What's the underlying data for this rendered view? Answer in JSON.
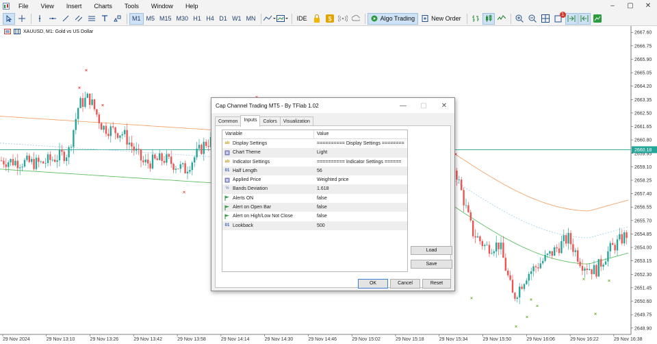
{
  "menubar": {
    "items": [
      "File",
      "View",
      "Insert",
      "Charts",
      "Tools",
      "Window",
      "Help"
    ],
    "window_controls": [
      "–",
      "▢",
      "✕"
    ]
  },
  "toolbar": {
    "timeframes": [
      "M1",
      "M5",
      "M15",
      "M30",
      "H1",
      "H4",
      "D1",
      "W1",
      "MN"
    ],
    "active_timeframe": "M1",
    "ide_label": "IDE",
    "algo_trading_label": "Algo Trading",
    "new_order_label": "New Order",
    "notification_count": "1"
  },
  "chart": {
    "symbol_label": "XAUUSD, M1:  Gold vs US Dollar",
    "current_price_label": "2660.18",
    "bg_color": "#ffffff",
    "bull_color": "#26a69a",
    "bear_color": "#ef5350"
  },
  "chart_data": {
    "type": "candlestick",
    "price_axis": [
      "2667.60",
      "2666.75",
      "2665.90",
      "2665.05",
      "2664.20",
      "2663.35",
      "2662.50",
      "2661.65",
      "2660.80",
      "2659.95",
      "2659.10",
      "2658.25",
      "2657.40",
      "2656.55",
      "2655.70",
      "2654.85",
      "2654.00",
      "2653.15",
      "2652.30",
      "2651.45",
      "2650.60",
      "2649.75",
      "2648.90"
    ],
    "time_axis": [
      "29 Nov 2024",
      "29 Nov 13:10",
      "29 Nov 13:26",
      "29 Nov 13:42",
      "29 Nov 13:58",
      "29 Nov 14:14",
      "29 Nov 14:30",
      "29 Nov 14:46",
      "29 Nov 15:02",
      "29 Nov 15:18",
      "29 Nov 15:34",
      "29 Nov 15:50",
      "29 Nov 16:06",
      "29 Nov 16:22",
      "29 Nov 16:38"
    ],
    "ylim": [
      2648.5,
      2668.0
    ],
    "current_price": 2660.18
  },
  "dialog": {
    "title": "Cap Channel Trading MT5 - By TFlab 1.02",
    "tabs": [
      "Common",
      "Inputs",
      "Colors",
      "Visualization"
    ],
    "active_tab": "Inputs",
    "table_header": {
      "variable": "Variable",
      "value": "Value"
    },
    "params": [
      {
        "icon": "ab-icon",
        "name": "Display Settings",
        "value": "========== Display Settings ========"
      },
      {
        "icon": "theme-icon",
        "name": "Chart Theme",
        "value": "Light"
      },
      {
        "icon": "ab-icon",
        "name": "Indicator Settings",
        "value": "========== Indicator Settings ======"
      },
      {
        "icon": "number-icon",
        "name": "Half Length",
        "value": "56"
      },
      {
        "icon": "theme-icon",
        "name": "Applied Price",
        "value": "Weighted price"
      },
      {
        "icon": "fraction-icon",
        "name": "Bands Deviation",
        "value": "1.618"
      },
      {
        "icon": "flag-icon",
        "name": "Alerts ON",
        "value": "false"
      },
      {
        "icon": "flag-icon",
        "name": "Alert on Open Bar",
        "value": "false"
      },
      {
        "icon": "flag-icon",
        "name": "Alert on High/Low Not Close",
        "value": "false"
      },
      {
        "icon": "number-icon",
        "name": "Lookback",
        "value": "500"
      }
    ],
    "load_label": "Load",
    "save_label": "Save",
    "ok_label": "OK",
    "cancel_label": "Cancel",
    "reset_label": "Reset",
    "close_glyph": "✕",
    "minimize_glyph": "—",
    "maximize_glyph": "▢"
  }
}
